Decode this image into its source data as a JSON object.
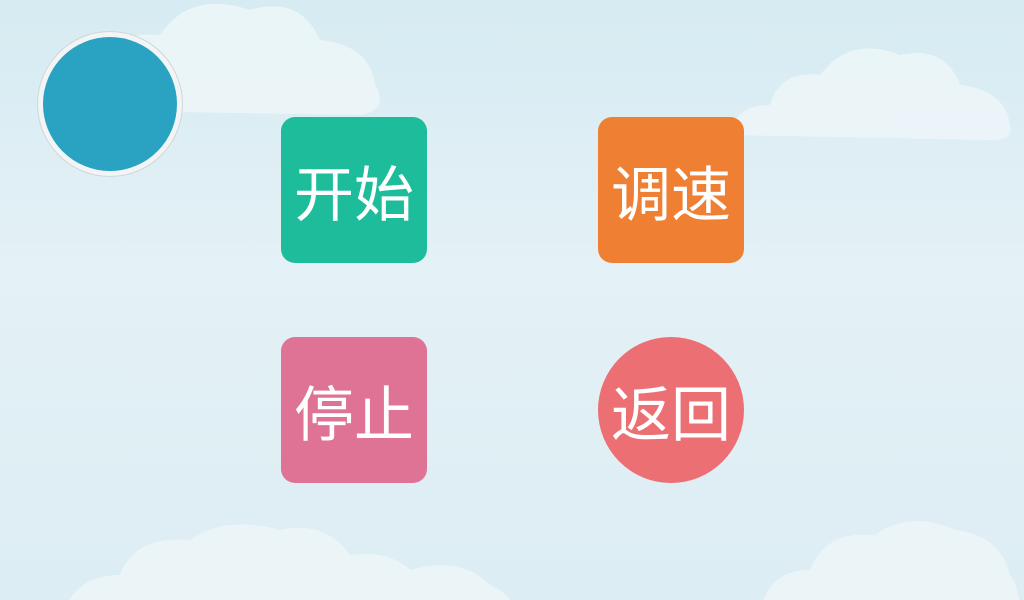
{
  "buttons": {
    "start": "开始",
    "speed": "调速",
    "stop": "停止",
    "back": "返回"
  },
  "colors": {
    "start": "#1dbd9b",
    "speed": "#ef7f32",
    "stop": "#df7395",
    "back": "#ec6f73",
    "status": "#2aa3c2"
  }
}
